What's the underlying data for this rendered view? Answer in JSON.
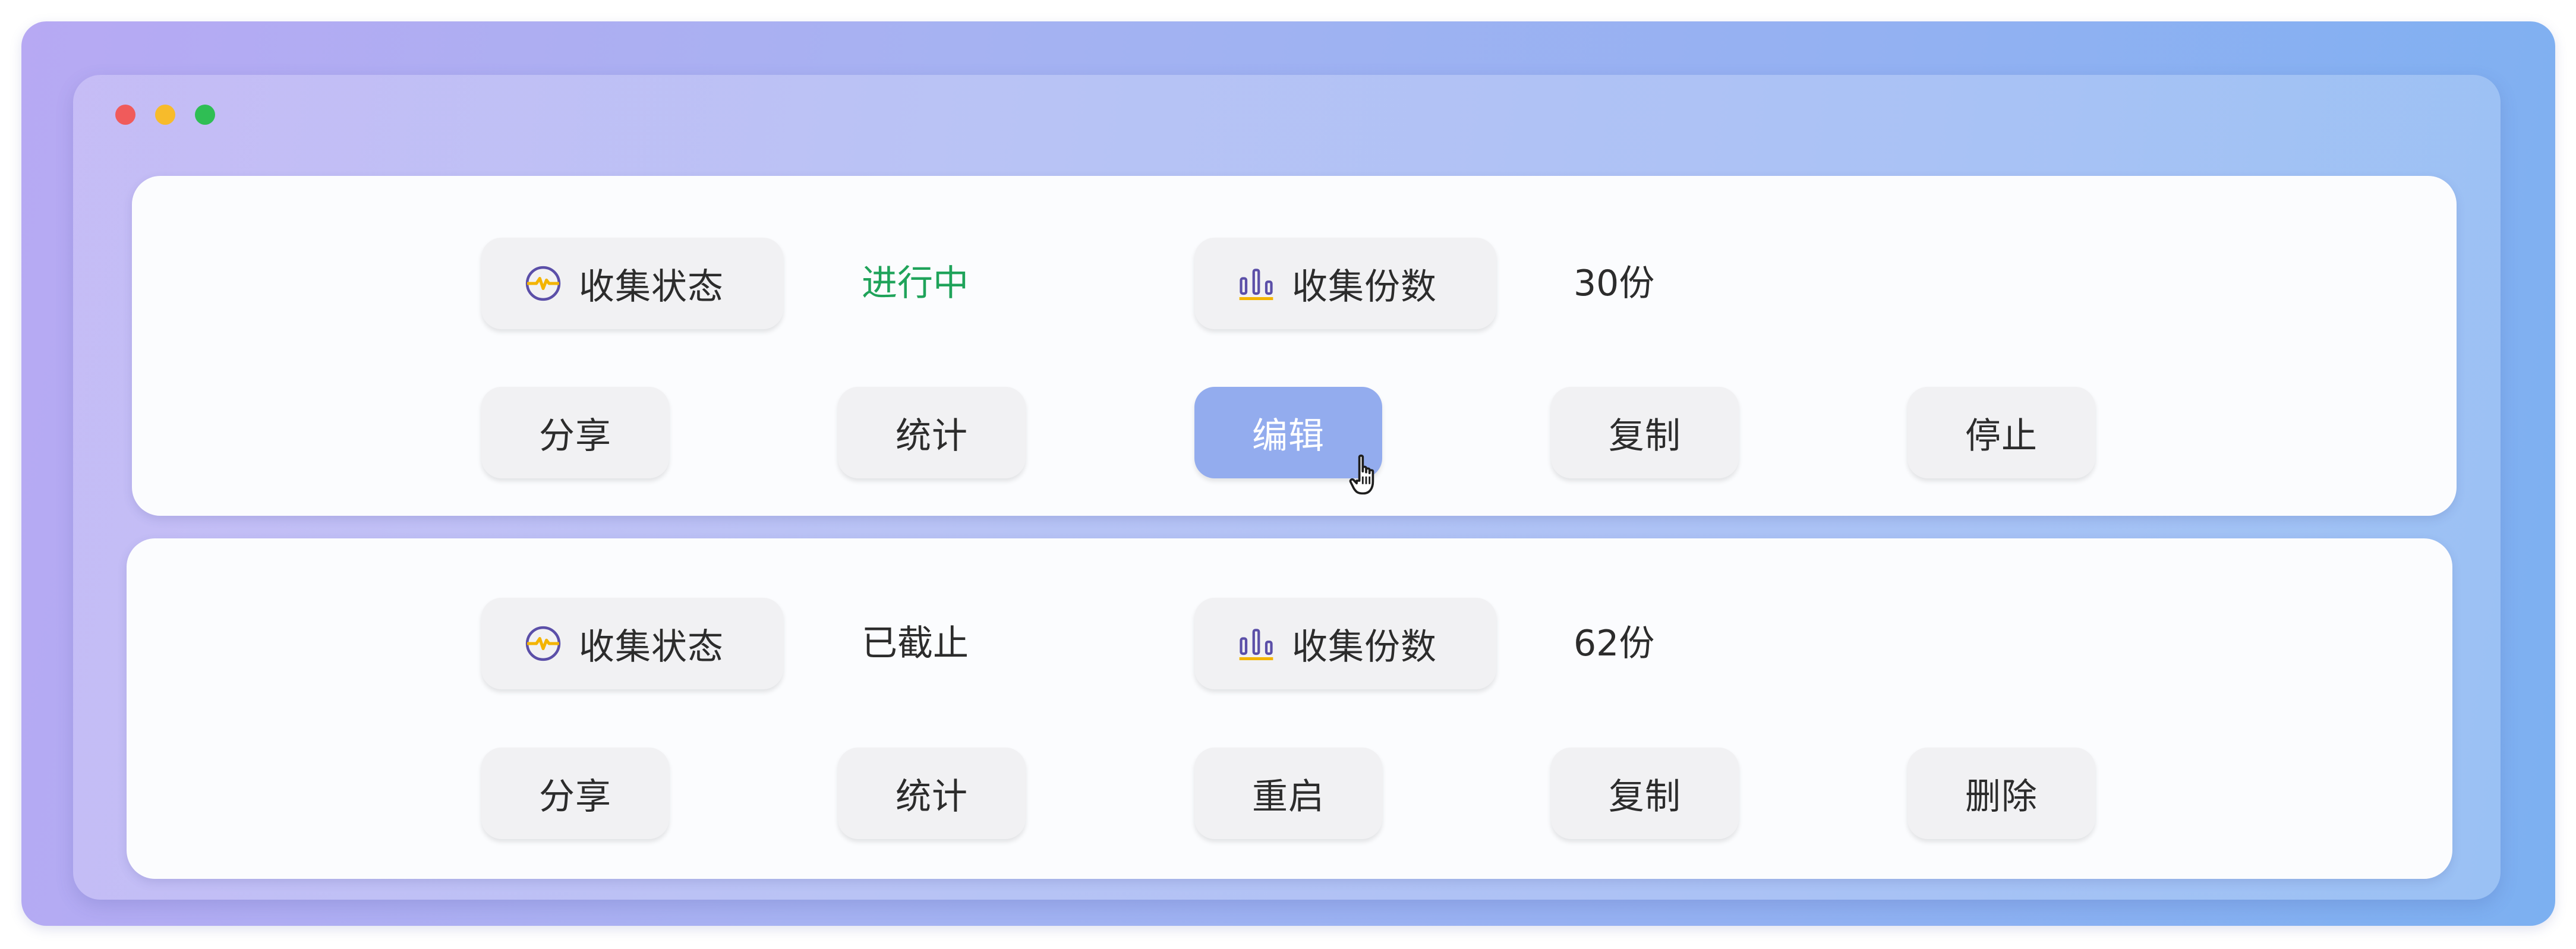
{
  "colors": {
    "status_active": "#1fa35a",
    "button_active_bg": "#93acee",
    "icon_ring": "#5b4fa8",
    "icon_spark": "#f3b400",
    "dot_close": "#f05b5b",
    "dot_minimize": "#f7bb2b",
    "dot_zoom": "#2fbe54"
  },
  "window": {
    "controls": [
      "close",
      "minimize",
      "zoom"
    ]
  },
  "cards": [
    {
      "status_label": "收集状态",
      "status_icon": "activity-icon",
      "status_value": "进行中",
      "count_label": "收集份数",
      "count_icon": "bar-chart-icon",
      "count_value": "30份",
      "actions": [
        {
          "label": "分享",
          "active": false
        },
        {
          "label": "统计",
          "active": false
        },
        {
          "label": "编辑",
          "active": true
        },
        {
          "label": "复制",
          "active": false
        },
        {
          "label": "停止",
          "active": false
        }
      ]
    },
    {
      "status_label": "收集状态",
      "status_icon": "activity-icon",
      "status_value": "已截止",
      "count_label": "收集份数",
      "count_icon": "bar-chart-icon",
      "count_value": "62份",
      "actions": [
        {
          "label": "分享",
          "active": false
        },
        {
          "label": "统计",
          "active": false
        },
        {
          "label": "重启",
          "active": false
        },
        {
          "label": "复制",
          "active": false
        },
        {
          "label": "删除",
          "active": false
        }
      ]
    }
  ]
}
